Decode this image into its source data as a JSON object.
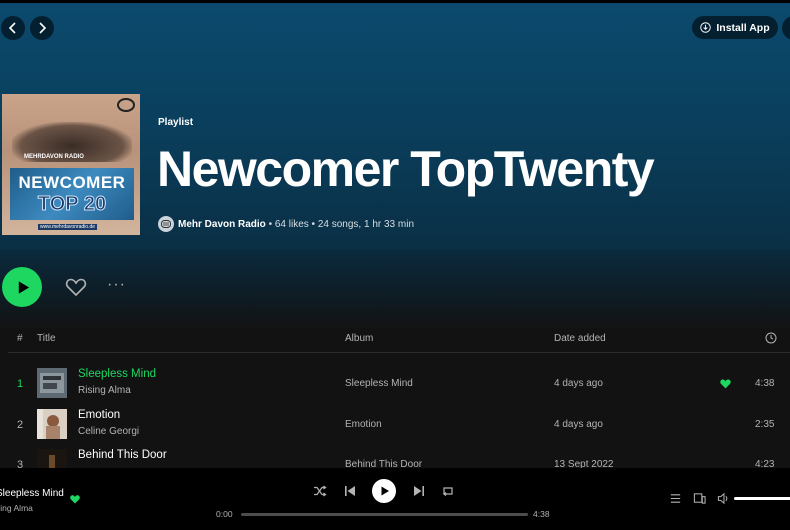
{
  "header": {
    "install_label": "Install App"
  },
  "playlist": {
    "type_label": "Playlist",
    "title": "Newcomer TopTwenty",
    "owner": "Mehr Davon Radio",
    "likes": "64 likes",
    "songs": "24 songs,",
    "duration": "1 hr 33 min",
    "cover": {
      "brand": "MEHRDAVON RADIO",
      "line1": "NEWCOMER",
      "line2": "TOP 20",
      "url": "www.mehrdavonradio.de"
    }
  },
  "table": {
    "headers": {
      "num": "#",
      "title": "Title",
      "album": "Album",
      "added": "Date added"
    },
    "rows": [
      {
        "num": "1",
        "title": "Sleepless Mind",
        "artist": "Rising Alma",
        "album": "Sleepless Mind",
        "added": "4 days ago",
        "duration": "4:38",
        "liked": true,
        "active": true
      },
      {
        "num": "2",
        "title": "Emotion",
        "artist": "Celine Georgi",
        "album": "Emotion",
        "added": "4 days ago",
        "duration": "2:35",
        "liked": false,
        "active": false
      },
      {
        "num": "3",
        "title": "Behind This Door",
        "artist": "",
        "album": "Behind This Door",
        "added": "13 Sept 2022",
        "duration": "4:23",
        "liked": false,
        "active": false
      }
    ]
  },
  "player": {
    "track": "Sleepless Mind",
    "artist": "Rising Alma",
    "elapsed": "0:00",
    "total": "4:38",
    "progress": 0
  },
  "colors": {
    "accent": "#1ed760",
    "hero": "#0b4a6e",
    "background": "#121212"
  }
}
